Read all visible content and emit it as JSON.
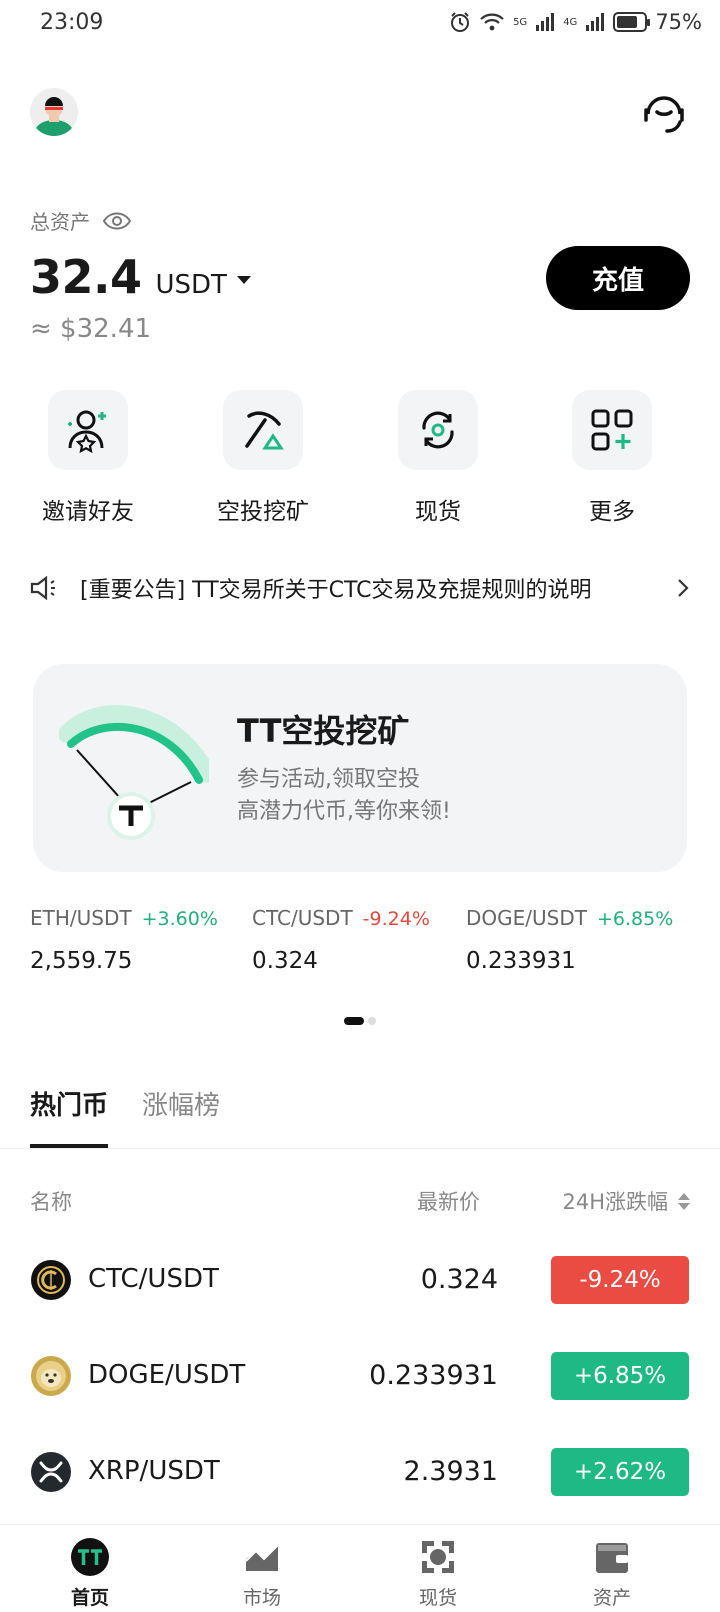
{
  "status_bar": {
    "time": "23:09",
    "battery": "75%",
    "battery_level": 0.75,
    "net1": "5G",
    "net2": "4G"
  },
  "header": {
    "avatar_icon": "user-avatar",
    "support_icon": "headset-icon"
  },
  "assets": {
    "label": "总资产",
    "balance": "32.4",
    "unit": "USDT",
    "fiat": "≈ $32.41",
    "deposit_label": "充值"
  },
  "actions": [
    {
      "label": "邀请好友",
      "icon": "invite-friends-icon"
    },
    {
      "label": "空投挖矿",
      "icon": "pickaxe-icon"
    },
    {
      "label": "现货",
      "icon": "spot-exchange-icon"
    },
    {
      "label": "更多",
      "icon": "more-grid-icon"
    }
  ],
  "notice": {
    "text": "[重要公告] TT交易所关于CTC交易及充提规则的说明"
  },
  "banner": {
    "title": "TT空投挖矿",
    "line1": "参与活动,领取空投",
    "line2": "高潜力代币,等你来领!"
  },
  "tickers": [
    {
      "pair": "ETH/USDT",
      "change": "+3.60%",
      "price": "2,559.75",
      "dir": "up"
    },
    {
      "pair": "CTC/USDT",
      "change": "-9.24%",
      "price": "0.324",
      "dir": "down"
    },
    {
      "pair": "DOGE/USDT",
      "change": "+6.85%",
      "price": "0.233931",
      "dir": "up"
    }
  ],
  "tabs": {
    "hot": "热门币",
    "gainers": "涨幅榜"
  },
  "table": {
    "col_name": "名称",
    "col_price": "最新价",
    "col_change": "24H涨跌幅",
    "rows": [
      {
        "pair": "CTC/USDT",
        "price": "0.324",
        "change": "-9.24%",
        "dir": "down",
        "color": "#111111"
      },
      {
        "pair": "DOGE/USDT",
        "price": "0.233931",
        "change": "+6.85%",
        "dir": "up",
        "color": "#c9a94a"
      },
      {
        "pair": "XRP/USDT",
        "price": "2.3931",
        "change": "+2.62%",
        "dir": "up",
        "color": "#23292f"
      }
    ]
  },
  "bottom_nav": [
    {
      "label": "首页",
      "icon": "home-tt-icon",
      "active": true
    },
    {
      "label": "市场",
      "icon": "market-chart-icon",
      "active": false
    },
    {
      "label": "现货",
      "icon": "spot-icon",
      "active": false
    },
    {
      "label": "资产",
      "icon": "wallet-icon",
      "active": false
    }
  ],
  "colors": {
    "up": "#1fb985",
    "down": "#ea4c43",
    "accent": "#22b07d"
  }
}
